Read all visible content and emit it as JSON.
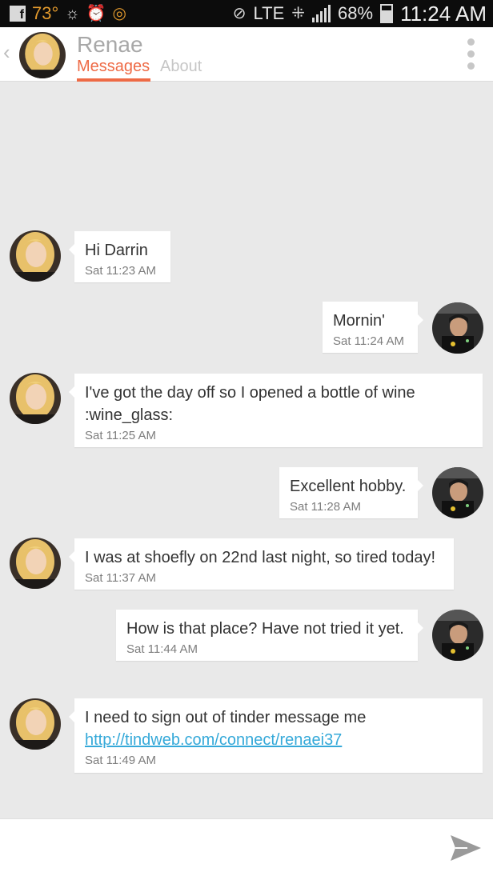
{
  "status_bar": {
    "temperature": "73°",
    "network": "LTE",
    "battery": "68%",
    "battery_level": 0.68,
    "time": "11:24 AM",
    "icons": [
      "facebook-icon",
      "weather-icon",
      "alarm-icon",
      "notification-icon",
      "mute-icon",
      "data-activity-icon",
      "signal-icon",
      "battery-icon"
    ]
  },
  "header": {
    "contact_name": "Renae",
    "tabs": [
      {
        "label": "Messages",
        "active": true
      },
      {
        "label": "About",
        "active": false
      }
    ],
    "accent_color": "#ee6a45"
  },
  "messages": [
    {
      "from": "Renae",
      "direction": "incoming",
      "text": "Hi Darrin",
      "time": "Sat 11:23 AM"
    },
    {
      "from": "Darrin",
      "direction": "outgoing",
      "text": "Mornin'",
      "time": "Sat 11:24 AM"
    },
    {
      "from": "Renae",
      "direction": "incoming",
      "text": "I've got the day off so I opened a bottle of wine :wine_glass:",
      "time": "Sat 11:25 AM"
    },
    {
      "from": "Darrin",
      "direction": "outgoing",
      "text": "Excellent hobby.",
      "time": "Sat 11:28 AM"
    },
    {
      "from": "Renae",
      "direction": "incoming",
      "text": "I was at shoefly on 22nd last night, so tired today!",
      "time": "Sat 11:37 AM"
    },
    {
      "from": "Darrin",
      "direction": "outgoing",
      "text": "How is that place? Have not tried it yet.",
      "time": "Sat 11:44 AM"
    },
    {
      "from": "Renae",
      "direction": "incoming",
      "text": "I need to sign out of tinder message me ",
      "link": "http://tindweb.com/connect/renaei37",
      "time": "Sat 11:49 AM"
    }
  ],
  "composer": {
    "value": "",
    "placeholder": "",
    "send_icon": "send-icon"
  },
  "colors": {
    "background": "#e9e9e9",
    "link": "#35a9d9"
  }
}
